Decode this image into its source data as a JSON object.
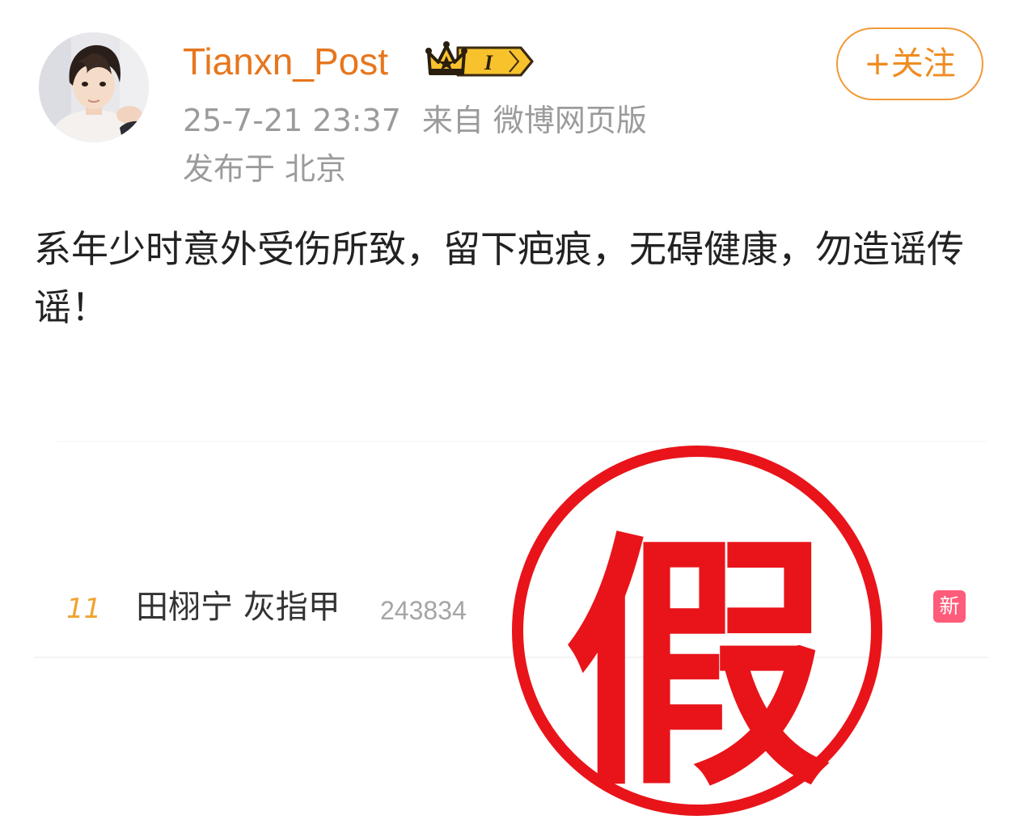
{
  "post": {
    "username": "Tianxn_Post",
    "badge_level": "I",
    "follow_label": "+关注",
    "time": "25-7-21 23:37",
    "source_prefix": "来自",
    "source": "微博网页版",
    "location_prefix": "发布于",
    "location": "北京",
    "text": "系年少时意外受伤所致，留下疤痕，无碍健康，勿造谣传谣！"
  },
  "trending": {
    "rank": "11",
    "title": "田栩宁 灰指甲",
    "count": "243834",
    "badge": "新"
  },
  "stamp": {
    "text": "假"
  },
  "icons": {
    "avatar": "avatar-photo",
    "crown": "crown-icon",
    "stamp": "fake-stamp"
  },
  "colors": {
    "username": "#e7761d",
    "follow": "#ee8d22",
    "meta": "#9b9b9b",
    "stamp": "#e8141a",
    "new_badge": "#ff5b7a",
    "rank": "#f0a430"
  }
}
